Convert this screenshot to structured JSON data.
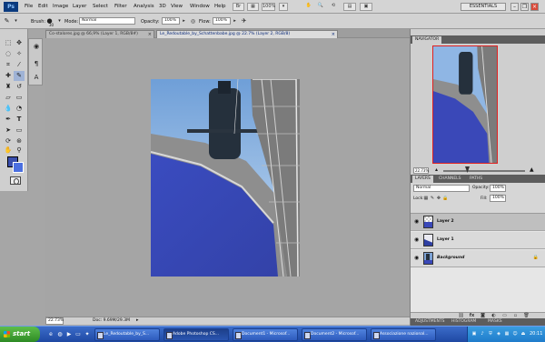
{
  "app": {
    "logo": "Ps",
    "menu": [
      "File",
      "Edit",
      "Image",
      "Layer",
      "Select",
      "Filter",
      "Analysis",
      "3D",
      "View",
      "Window",
      "Help"
    ],
    "zoom_readout": "100%",
    "workspace": "ESSENTIALS"
  },
  "options": {
    "brush_label": "Brush:",
    "brush_size": "30",
    "mode_label": "Mode:",
    "mode_value": "Normal",
    "opacity_label": "Opacity:",
    "opacity_value": "100%",
    "flow_label": "Flow:",
    "flow_value": "100%"
  },
  "tabs": [
    {
      "label": "Co-stalores.jpg @ 66,9% (Layer 1, RGB/8#)",
      "active": false
    },
    {
      "label": "Le_Redoutable_by_Schattenbabe.jpg @ 22.7% (Layer 2, RGB/8)",
      "active": true
    }
  ],
  "status": {
    "zoom": "22.73%",
    "doc_size": "Doc: 9.69M/29.3M"
  },
  "navigator": {
    "tabs": [
      "NAVIGATOR"
    ],
    "zoom": "22.73%"
  },
  "layers": {
    "panel_tabs": [
      "LAYERS",
      "CHANNELS",
      "PATHS"
    ],
    "blend_mode": "Normal",
    "opacity_label": "Opacity:",
    "opacity_value": "100%",
    "lock_label": "Lock:",
    "fill_label": "Fill:",
    "fill_value": "100%",
    "items": [
      {
        "name": "Layer 2",
        "selected": true,
        "italic": false
      },
      {
        "name": "Layer 1",
        "selected": false,
        "italic": false
      },
      {
        "name": "Background",
        "selected": false,
        "italic": true
      }
    ]
  },
  "bottom_panel_tabs": [
    "ADJUSTMENTS",
    "HISTOGRAM",
    "MASKS"
  ],
  "taskbar": {
    "start": "start",
    "buttons": [
      {
        "label": "Le_Redoutable_by_S...",
        "active": false
      },
      {
        "label": "Adobe Photoshop CS...",
        "active": true
      },
      {
        "label": "Document1 - Microsof...",
        "active": false
      },
      {
        "label": "Document2 - Microsof...",
        "active": false
      },
      {
        "label": "Associazione nazional...",
        "active": false
      }
    ],
    "clock": "20:11"
  },
  "colors": {
    "foreground": "#3a4fae",
    "background": "#4b6fe0",
    "sky": "#9ec1ea",
    "hull_paint": "#3a48b8",
    "taskbar": "#245edb"
  }
}
